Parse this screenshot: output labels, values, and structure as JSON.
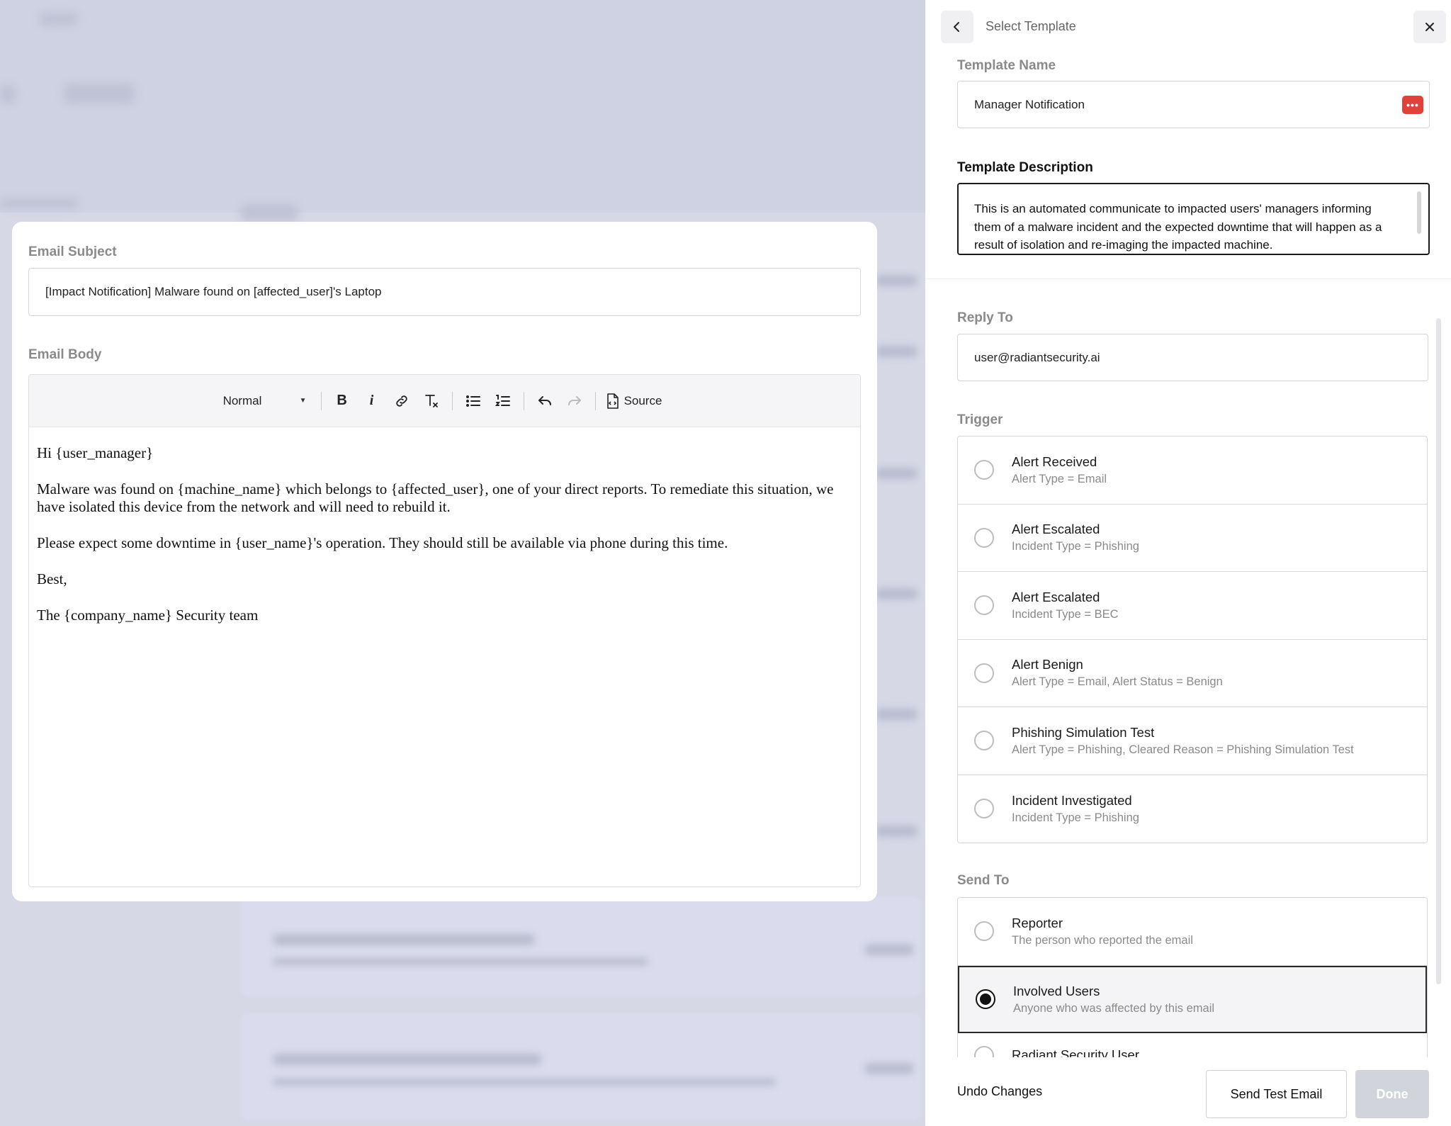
{
  "colors": {
    "danger": "#e0413a",
    "muted": "#8a8a8a",
    "disabled_button": "#d2d4dc"
  },
  "editor": {
    "subject_label": "Email Subject",
    "subject_value": "[Impact Notification]  Malware found on [affected_user]'s Laptop",
    "body_label": "Email Body",
    "toolbar": {
      "format_value": "Normal",
      "bold": "B",
      "italic": "i",
      "source_label": "Source"
    },
    "body_paragraphs": [
      "Hi {user_manager}",
      "Malware was found on {machine_name} which belongs to {affected_user}, one of your direct reports.  To remediate this situation, we have isolated this device from the network and will need to rebuild it.",
      "Please expect some downtime in {user_name}'s operation. They should still be available via phone during this time.",
      "Best,",
      "The {company_name} Security team"
    ]
  },
  "panel": {
    "title": "Select Template",
    "template_name_label": "Template Name",
    "template_name_value": "Manager Notification",
    "password_badge_icon": "dots-icon",
    "template_description_label": "Template Description",
    "template_description_value": "This is an automated communicate to impacted users' managers informing them of a malware incident and the expected downtime that will happen as a result of isolation and re-imaging the impacted machine.",
    "reply_to_label": "Reply To",
    "reply_to_value": "user@radiantsecurity.ai",
    "trigger_label": "Trigger",
    "triggers": [
      {
        "title": "Alert Received",
        "sub": "Alert Type = Email",
        "selected": false
      },
      {
        "title": "Alert Escalated",
        "sub": "Incident Type = Phishing",
        "selected": false
      },
      {
        "title": "Alert Escalated",
        "sub": "Incident Type = BEC",
        "selected": false
      },
      {
        "title": "Alert Benign",
        "sub": "Alert Type = Email, Alert Status = Benign",
        "selected": false
      },
      {
        "title": "Phishing Simulation Test",
        "sub": "Alert Type = Phishing, Cleared Reason = Phishing Simulation Test",
        "selected": false
      },
      {
        "title": "Incident Investigated",
        "sub": "Incident Type = Phishing",
        "selected": false
      }
    ],
    "send_to_label": "Send To",
    "send_to": [
      {
        "title": "Reporter",
        "sub": "The person who reported the email",
        "selected": false
      },
      {
        "title": "Involved Users",
        "sub": "Anyone who was affected by this email",
        "selected": true
      },
      {
        "title": "Radiant Security User",
        "sub": "",
        "selected": false
      }
    ],
    "footer": {
      "undo_label": "Undo Changes",
      "send_test_label": "Send Test Email",
      "done_label": "Done"
    }
  }
}
